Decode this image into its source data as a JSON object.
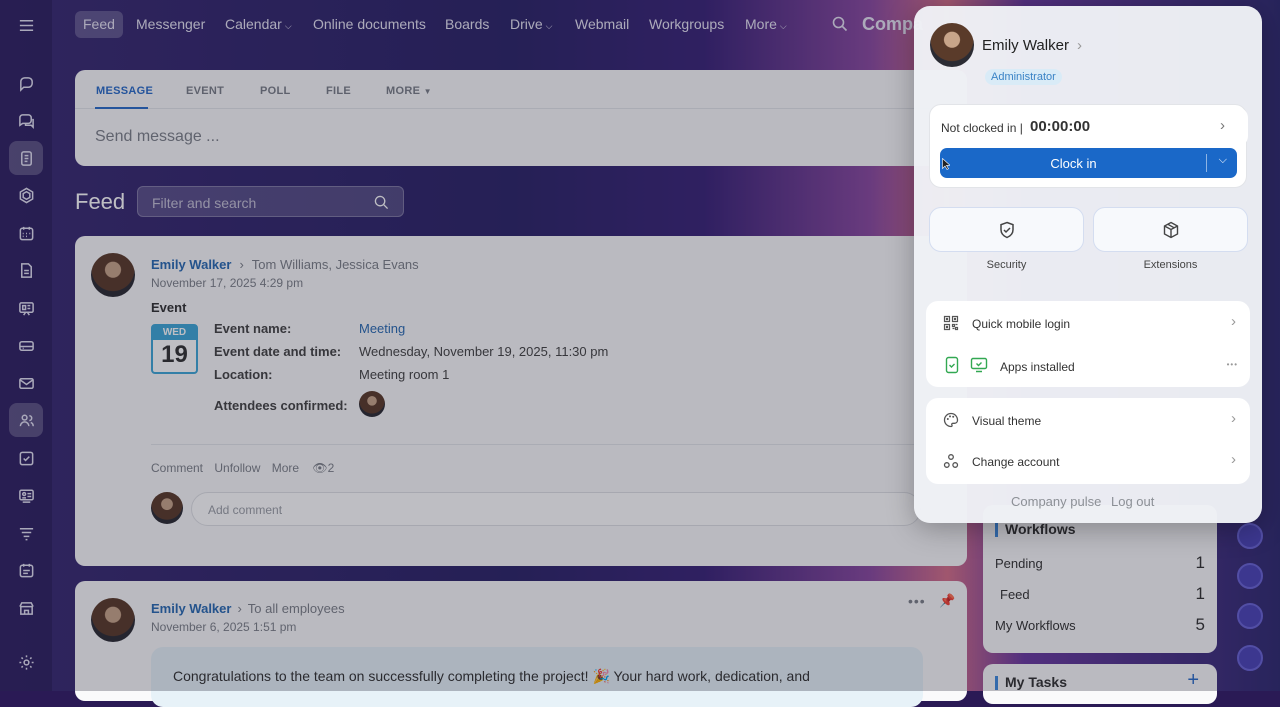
{
  "topbar": {
    "nav": [
      "Feed",
      "Messenger",
      "Calendar",
      "Online documents",
      "Boards",
      "Drive",
      "Webmail",
      "Workgroups",
      "More"
    ],
    "company": "Compa"
  },
  "composer": {
    "tabs": [
      "MESSAGE",
      "EVENT",
      "POLL",
      "FILE",
      "MORE"
    ],
    "placeholder": "Send message ..."
  },
  "feed": {
    "title": "Feed",
    "search_placeholder": "Filter and search"
  },
  "post1": {
    "author": "Emily Walker",
    "recipients": "Tom Williams, Jessica Evans",
    "date": "November 17, 2025 4:29 pm",
    "type": "Event",
    "cal_day": "WED",
    "cal_num": "19",
    "fields": [
      {
        "label": "Event name:",
        "value": "Meeting"
      },
      {
        "label": "Event date and time:",
        "value": "Wednesday, November 19, 2025, 11:30 pm"
      },
      {
        "label": "Location:",
        "value": "Meeting room 1"
      },
      {
        "label": "Attendees confirmed:",
        "value": ""
      }
    ],
    "actions": {
      "comment": "Comment",
      "unfollow": "Unfollow",
      "more": "More",
      "views": "2"
    },
    "comment_placeholder": "Add comment"
  },
  "post2": {
    "author": "Emily Walker",
    "recipients": "To all employees",
    "date": "November 6, 2025 1:51 pm",
    "text": "Congratulations to the team on successfully completing the project! 🎉 Your hard work, dedication, and"
  },
  "workflows": {
    "title": "Workflows",
    "rows": [
      {
        "label": "Pending",
        "count": "1"
      },
      {
        "label": "Feed",
        "count": "1"
      },
      {
        "label": "My Workflows",
        "count": "5"
      }
    ]
  },
  "tasks": {
    "title": "My Tasks",
    "add": "+"
  },
  "popup": {
    "name": "Emily Walker",
    "role": "Administrator",
    "clock_status": "Not clocked in |",
    "time": "00:00:00",
    "clock_button": "Clock in",
    "security": "Security",
    "extensions": "Extensions",
    "quick_login": "Quick mobile login",
    "apps": "Apps installed",
    "apps_more": "•••",
    "theme": "Visual theme",
    "change_account": "Change account",
    "pulse": "Company pulse",
    "logout": "Log out"
  }
}
